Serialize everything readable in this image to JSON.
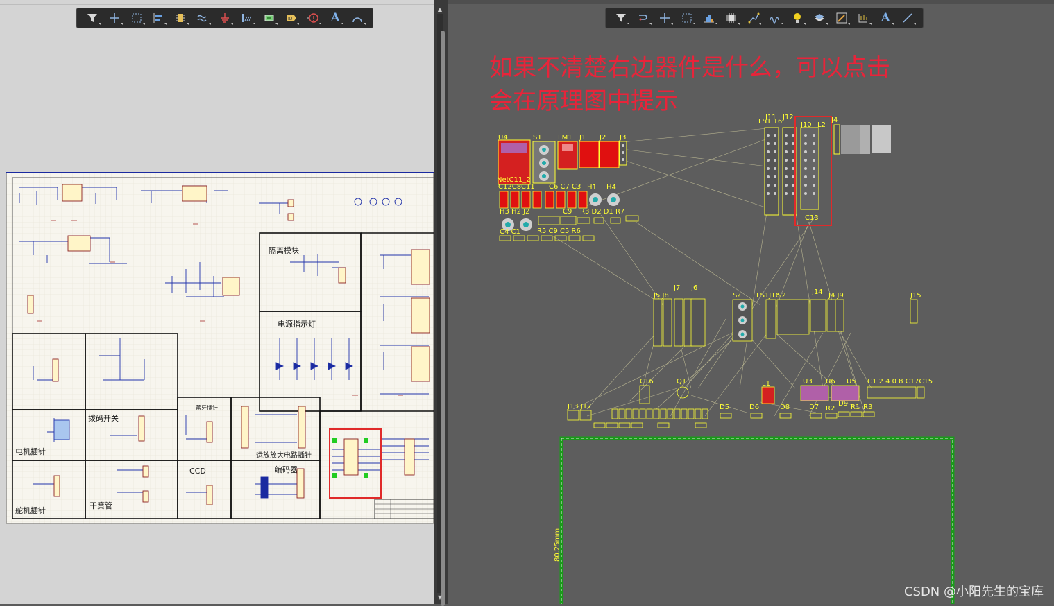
{
  "toolbar_left": {
    "tools": [
      "filter-icon",
      "plus-icon",
      "select-rect-icon",
      "align-icon",
      "component-icon",
      "net-label-icon",
      "ground-icon",
      "bus-icon",
      "port-icon",
      "parameter-icon",
      "warning-icon",
      "text-icon",
      "arc-icon"
    ],
    "text_tool_label": "A"
  },
  "toolbar_right": {
    "tools": [
      "filter-icon",
      "route-icon",
      "plus-icon",
      "select-rect-icon",
      "chart-icon",
      "chip-icon",
      "track-icon",
      "diff-pair-icon",
      "bulb-icon",
      "layers-icon",
      "edit-icon",
      "dimension-icon",
      "text-icon",
      "line-icon"
    ],
    "text_tool_label": "A"
  },
  "schematic": {
    "section_labels": {
      "isolation": "隔离模块",
      "power_led": "电源指示灯",
      "motor": "电机插针",
      "dip": "拨码开关",
      "bluetooth": "蓝牙插针",
      "opamp": "运放放大电路插针",
      "servo": "舵机插针",
      "reed": "干簧管",
      "ccd": "CCD",
      "encoder": "编码器"
    }
  },
  "annotation": {
    "line1": "如果不清楚右边器件是什么，可以点击",
    "line2": "会在原理图中提示"
  },
  "pcb": {
    "labels": {
      "u4": "U4",
      "s1": "S1",
      "lm1": "LM1",
      "j1": "J1",
      "j2": "J2",
      "j3": "J3",
      "net": "NetC11_2",
      "c12c8c11": "C12C8C11",
      "c6c7c3": "C6 C7 C3",
      "h1": "H1",
      "h4": "H4",
      "h3h2j2": "H3  H2  J2",
      "c9": "C9",
      "r3d2d1r7": "R3  D2  D1  R7",
      "c4c1": "C4 C1",
      "r5c9c5r6": "R5 C9 C5 R6",
      "j11": "J11",
      "j12": "J12",
      "j10": "J10",
      "l2": "L2",
      "c13": "C13",
      "j4top": "J4",
      "ls": "LS1 16",
      "j5j8": "J5 J8",
      "j7": "J7",
      "j6": "J6",
      "s7": "S?",
      "ls1j16": "LS1J16",
      "s2": "S2",
      "j14": "J14",
      "j4j9": "J4 J9",
      "j15": "J15",
      "c16": "C16",
      "q1": "Q1",
      "l1": "L1",
      "u3": "U3",
      "u6": "U6",
      "u5": "U5",
      "c1c17c15": "C1 2 4 0 8 C17C15",
      "j13j17": "J13 J17",
      "d5": "D5",
      "d6": "D6",
      "d8": "D8",
      "d7": "D7",
      "r2": "R2",
      "r1": "R1",
      "r3b": "R3",
      "d9": "D9",
      "dimension": "80.25mm"
    }
  },
  "watermark": "CSDN @小阳先生的宝库"
}
